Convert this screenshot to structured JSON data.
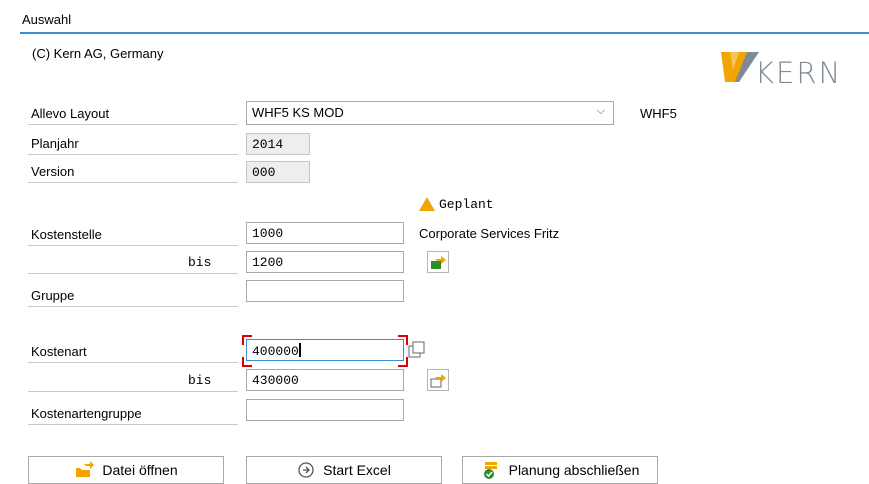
{
  "group": {
    "title": "Auswahl"
  },
  "header": {
    "copyright": "(C) Kern AG, Germany",
    "logo_text": "KERN"
  },
  "layout": {
    "label": "Allevo Layout",
    "value": "WHF5 KS MOD",
    "code": "WHF5"
  },
  "planjahr": {
    "label": "Planjahr",
    "value": "2014"
  },
  "version": {
    "label": "Version",
    "value": "000"
  },
  "status": {
    "text": "Geplant",
    "color": "#f0a500",
    "icon": "warning-triangle-icon"
  },
  "kostenstelle": {
    "label": "Kostenstelle",
    "from": "1000",
    "bis_label": "bis",
    "to": "1200",
    "description": "Corporate Services Fritz"
  },
  "gruppe": {
    "label": "Gruppe",
    "value": ""
  },
  "kostenart": {
    "label": "Kostenart",
    "from": "400000",
    "bis_label": "bis",
    "to": "430000"
  },
  "kostenartengruppe": {
    "label": "Kostenartengruppe",
    "value": ""
  },
  "buttons": {
    "datei": "Datei öffnen",
    "excel": "Start Excel",
    "planung": "Planung abschließen"
  },
  "colors": {
    "accent": "#3d8fd1",
    "focus": "#e00000",
    "logo_orange": "#f0a500",
    "logo_gray": "#7f8a94"
  }
}
